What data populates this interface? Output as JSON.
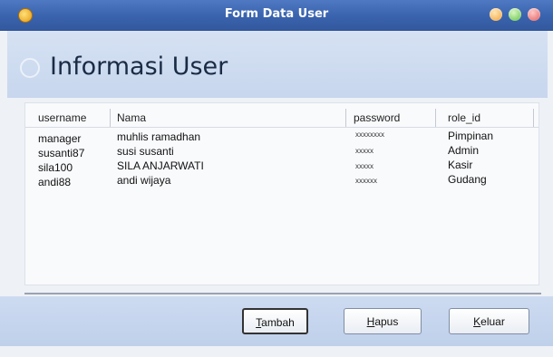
{
  "window": {
    "title": "Form Data User"
  },
  "header": {
    "title": "Informasi User"
  },
  "table": {
    "columns": [
      "username",
      "Nama",
      "password",
      "role_id"
    ],
    "rows": [
      [
        "manager",
        "muhlis ramadhan",
        "xxxxxxxx",
        "Pimpinan"
      ],
      [
        "susanti87",
        "susi susanti",
        "xxxxx",
        "Admin"
      ],
      [
        "sila100",
        "SILA ANJARWATI",
        "xxxxx",
        "Kasir"
      ],
      [
        "andi88",
        "andi wijaya",
        "xxxxxx",
        "Gudang"
      ]
    ]
  },
  "buttons": {
    "tambah": {
      "accel": "T",
      "rest": "ambah"
    },
    "hapus": {
      "accel": "H",
      "rest": "apus"
    },
    "keluar": {
      "accel": "K",
      "rest": "eluar"
    }
  }
}
